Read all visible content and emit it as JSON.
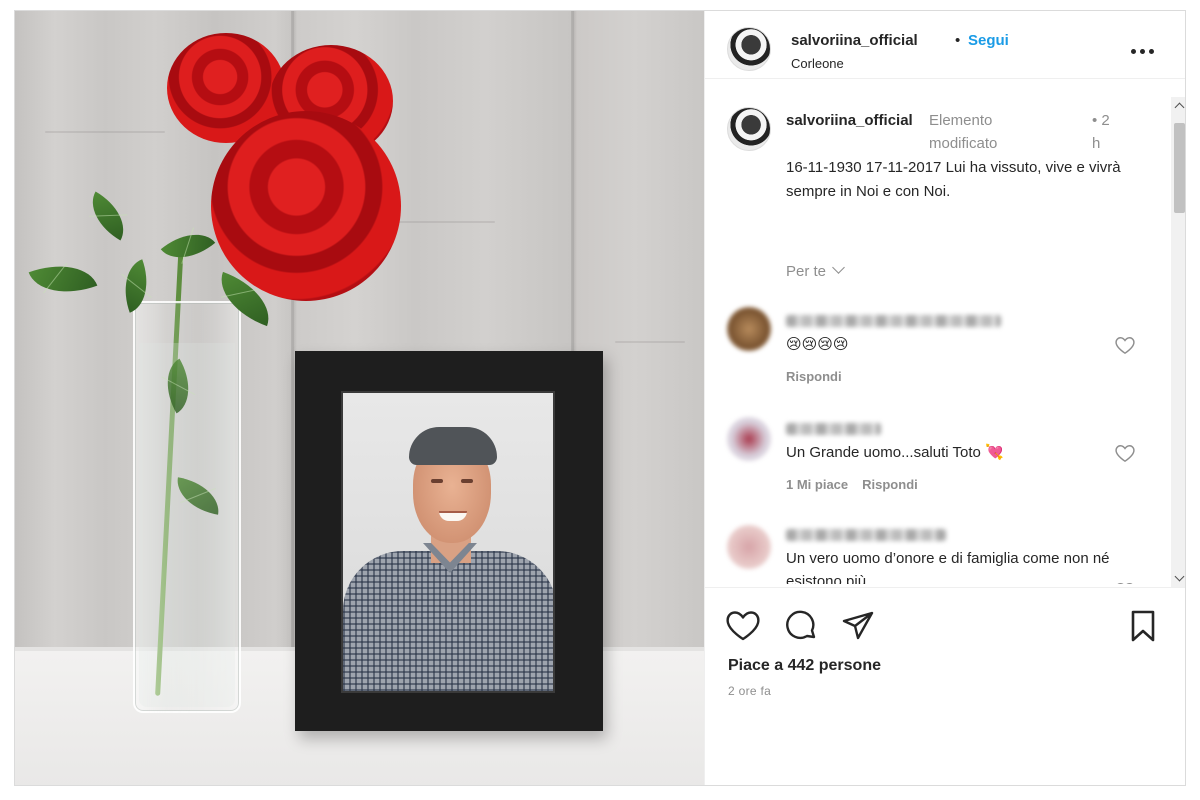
{
  "post": {
    "username": "salvoriina_official",
    "follow_separator": "•",
    "follow_label": "Segui",
    "location": "Corleone",
    "more_icon": "more-horizontal-icon"
  },
  "caption": {
    "username": "salvoriina_official",
    "edited_label": "Elemento modificato",
    "time": "• 2 h",
    "text": "16-11-1930 17-11-2017 Lui ha vissuto, vive e vivrà sempre in Noi e con Noi.",
    "translate_label": "Per te"
  },
  "comments": [
    {
      "text": "😢😢😢😢",
      "meta": [
        "Rispondi"
      ]
    },
    {
      "text": "Un Grande uomo...saluti Toto 💘",
      "meta": [
        "1 Mi piace",
        "Rispondi"
      ]
    },
    {
      "text": "Un vero uomo d’onore e di famiglia come non né esistono più.",
      "meta": []
    }
  ],
  "actions": {
    "icons": [
      "heart-icon",
      "comment-icon",
      "share-icon",
      "bookmark-icon"
    ],
    "likes_label": "Piace a 442 persone",
    "posted_label": "2 ore fa"
  },
  "colors": {
    "accent": "#1a9be6",
    "muted": "#8e8e8e",
    "text": "#262626",
    "rose": "#c0141a"
  }
}
